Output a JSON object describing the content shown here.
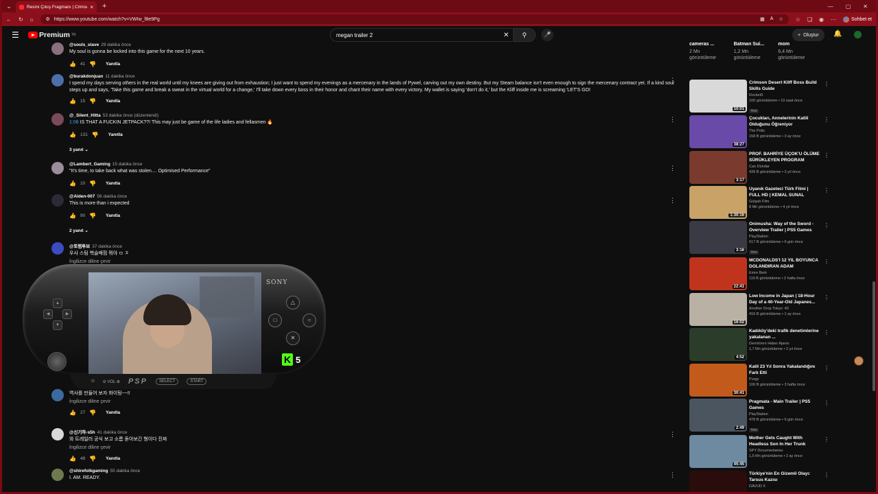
{
  "browser": {
    "tab_title": "Resmi Çıkış Fragmanı | Crimson D...",
    "url": "https://www.youtube.com/watch?v=VWIw_f8e9Pg",
    "chat_label": "Sohbet et"
  },
  "header": {
    "logo_text": "Premium",
    "logo_sup": "TR",
    "search_query": "megan trailer 2",
    "create_label": "Oluştur"
  },
  "comments": [
    {
      "author": "@souls_slave",
      "ago": "29 dakika önce",
      "text": "My soul is gonna be locked into this game for the next 10 years.",
      "likes": "41",
      "reply": "Yanıtla"
    },
    {
      "author": "@burakdonjuan",
      "ago": "11 dakika önce",
      "text": "I spend my days serving others in the real world until my knees are giving out from exhaustion; I just want to spend my evenings as a mercenary in the lands of Pywel, carving out my own destiny. But my Steam balance isn't even enough to sign the mercenary contract yet. If a kind soul steps up and says, 'Take this game and break a sweat in the virtual world for a change,' I'll take down every boss in their honor and chant their name with every victory. My wallet is saying 'don't do it,' but the Kliff inside me is screaming 'LET'S GO!",
      "likes": "15",
      "reply": "Yanıtla"
    },
    {
      "author": "@_Silent_Hitta",
      "ago": "53 dakika önce (düzenlendi)",
      "timestamp": "1:08",
      "text": " IS THAT A FUCKIN JETPACK??! This may just be game of the life ladies and fellasmen 🔥",
      "likes": "131",
      "reply": "Yanıtla",
      "replies": "3 yanıt"
    },
    {
      "author": "@Lambert_Gaming",
      "ago": "15 dakika önce",
      "text": "\"It's time, to take back what was stolen.... Optimised Performance\"",
      "likes": "10",
      "reply": "Yanıtla"
    },
    {
      "author": "@Alden-007",
      "ago": "56 dakika önce",
      "text": "This is more than i expected",
      "likes": "90",
      "reply": "Yanıtla",
      "replies": "2 yanıt"
    },
    {
      "author": "@또렴투브",
      "ago": "37 dakika önce",
      "text": "우사 스팀 핵슬배핌 뭐야 ㅁ ㅈ",
      "translate": "İngilizce diline çevir"
    },
    {
      "author": "",
      "ago": "",
      "text": "역사를 만들어 보자 화이팅~~!!",
      "translate": "İngilizce diline çevir",
      "likes": "27",
      "reply": "Yanıtla"
    },
    {
      "author": "@신기하-s5h",
      "ago": "41 dakika önce",
      "text": "와 트레일러 공식 보고 소름 돋아보긴 형이다 진짜",
      "translate": "İngilizce diline çevir",
      "likes": "48",
      "reply": "Yanıtla"
    },
    {
      "author": "@shirefolkgaming",
      "ago": "55 dakika önce",
      "text": "I. AM. READY."
    }
  ],
  "top_cards": [
    {
      "title": "cameras ...",
      "views": "2 Mn",
      "label": "görüntüleme"
    },
    {
      "title": "Batman Sui...",
      "views": "1,2 Mn",
      "label": "görüntüleme"
    },
    {
      "title": "mom",
      "views": "6,4 Mn",
      "label": "görüntüleme"
    }
  ],
  "sidebar": [
    {
      "title": "Crimson Desert Kliff Boss Build Skills Guide",
      "channel": "Rocket9",
      "meta": "100 görüntüleme • 10 saat önce",
      "badge": "Yeni",
      "duration": "10:01",
      "color": "#d9d9d9"
    },
    {
      "title": "Çocukları, Annelerinin Katili Olduğunu Öğreniyor",
      "channel": "The Polis",
      "meta": "158 B görüntüleme • 3 ay önce",
      "badge": "",
      "duration": "38:27",
      "color": "#6a4aa8"
    },
    {
      "title": "PROF. BAHRİYE ÜÇOK'U ÖLÜME SÜRÜKLEYEN PROGRAM",
      "channel": "Can Dündar",
      "meta": "439 B görüntüleme • 3 yıl önce",
      "badge": "",
      "duration": "3:17",
      "color": "#7a3b2e"
    },
    {
      "title": "Uyanık Gazeteci Türk Filmi | FULL HD | KEMAL SUNAL",
      "channel": "Gülşah Film",
      "meta": "8 Mn görüntüleme • 4 yıl önce",
      "badge": "",
      "duration": "1:30:16",
      "color": "#c8a267"
    },
    {
      "title": "Onimusha: Way of the Sword - Overview Trailer | PS5 Games",
      "channel": "PlayStation",
      "meta": "617 B görüntüleme • 6 gün önce",
      "badge": "Yeni",
      "duration": "3:16",
      "color": "#3a3a44"
    },
    {
      "title": "MCDONALDS'I 12 YIL BOYUNCA DOLANDIRAN ADAM",
      "channel": "Emre Berk",
      "meta": "119 B görüntüleme • 2 hafta önce",
      "badge": "",
      "duration": "22:41",
      "color": "#c0341d"
    },
    {
      "title": "Low Income in Japan | 18-Hour Day of a 40-Year-Old Japanes...",
      "channel": "Another Drop Tokyo: 40",
      "meta": "416 B görüntüleme • 1 ay önce",
      "badge": "",
      "duration": "16:02",
      "color": "#b9b2a4"
    },
    {
      "title": "Kadıköy'deki trafik denetimlerine yakalanan ...",
      "channel": "Demirören Haber Ajansı",
      "meta": "1,7 Mn görüntüleme • 2 yıl önce",
      "badge": "",
      "duration": "4:52",
      "color": "#2b3d2a"
    },
    {
      "title": "Katil 23 Yıl Sonra Yakalandığını Fark Etti",
      "channel": "Purgy",
      "meta": "106 B görüntüleme • 3 hafta önce",
      "badge": "",
      "duration": "30:41",
      "color": "#c25a1c"
    },
    {
      "title": "Pragmata - Main Trailer | PS5 Games",
      "channel": "PlayStation",
      "meta": "478 B görüntüleme • 6 gün önce",
      "badge": "Yeni",
      "duration": "2:49",
      "color": "#4b5560"
    },
    {
      "title": "Mother Gets Caught With Headless Son In Her Trunk",
      "channel": "SPY Documentaries",
      "meta": "1,5 Mn görüntüleme • 2 ay önce",
      "badge": "",
      "duration": "45:45",
      "color": "#6d8aa0"
    },
    {
      "title": "Türkiye'nin En Gizemli Olayı: Tarsus Kazısı",
      "channel": "DAVUD X",
      "meta": "",
      "badge": "",
      "duration": "",
      "color": "#2a0c0c"
    }
  ],
  "overlay": {
    "brand": "SONY",
    "psp_logo": "PSP",
    "vol": "VOL",
    "select": "SELECT",
    "start": "START",
    "kick_count": "5"
  }
}
